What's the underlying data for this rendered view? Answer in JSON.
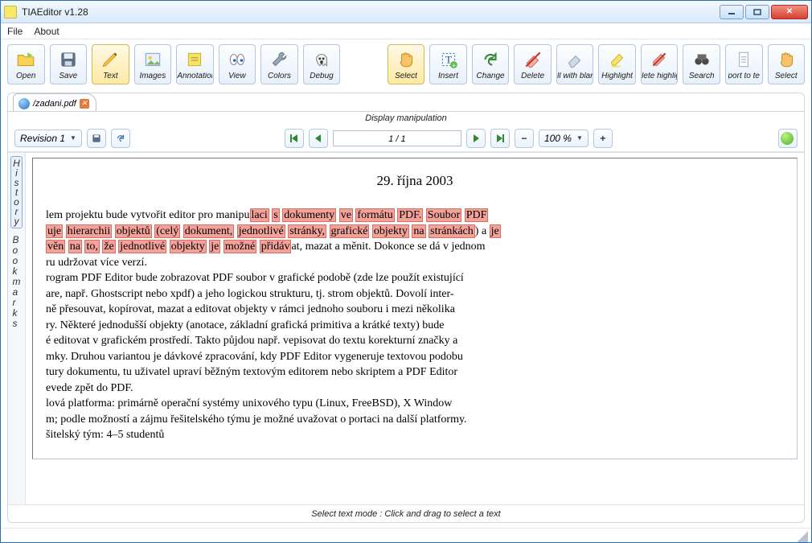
{
  "window": {
    "title": "TIAEditor v1.28"
  },
  "menu": {
    "file": "File",
    "about": "About"
  },
  "toolbar": [
    {
      "id": "open-button",
      "label": "Open"
    },
    {
      "id": "save-button",
      "label": "Save"
    },
    {
      "id": "text-button",
      "label": "Text",
      "selected": true
    },
    {
      "id": "images-button",
      "label": "Images"
    },
    {
      "id": "annotations-button",
      "label": "Annotations"
    },
    {
      "id": "view-button",
      "label": "View"
    },
    {
      "id": "colors-button",
      "label": "Colors"
    },
    {
      "id": "debug-button",
      "label": "Debug"
    }
  ],
  "toolbar2": [
    {
      "id": "select-button",
      "label": "Select",
      "selected": true
    },
    {
      "id": "insert-button",
      "label": "Insert"
    },
    {
      "id": "change-button",
      "label": "Change"
    },
    {
      "id": "delete-button",
      "label": "Delete"
    },
    {
      "id": "fill-blank-button",
      "label": "ll with blan"
    },
    {
      "id": "highlight-button",
      "label": "Highlight"
    },
    {
      "id": "delete-highlight-button",
      "label": "lete highlig"
    },
    {
      "id": "search-button",
      "label": "Search"
    },
    {
      "id": "port-to-te-button",
      "label": "port to te"
    },
    {
      "id": "select2-button",
      "label": "Select"
    }
  ],
  "tab": {
    "label": "/zadani.pdf"
  },
  "display_label": "Display manipulation",
  "revision": {
    "label": "Revision 1"
  },
  "page_counter": "1 / 1",
  "zoom": "100 %",
  "doc": {
    "date": "29. října 2003",
    "p1a": "lem projektu bude vytvořit editor pro manipu",
    "p1_hl": [
      "laci",
      "s",
      "dokumenty",
      "ve",
      "formátu",
      "PDF.",
      "Soubor",
      "PDF"
    ],
    "p2_hl1": [
      "uje",
      "hierarchii",
      "objektů",
      "(celý",
      "dokument,",
      "jednotlivé",
      "stránky,",
      "grafické",
      "objekty",
      "na",
      "stránkách"
    ],
    "p2_mid": ") a ",
    "p2_hl2": [
      "je"
    ],
    "p3_hl": [
      "věn",
      "na",
      "to,",
      "že",
      "jednotlivé",
      "objekty",
      "je",
      "možné",
      "přidáv"
    ],
    "p3b": "at, mazat a měnit. Dokonce se dá v jednom",
    "p4": "ru udržovat více verzí.",
    "p5": "rogram PDF Editor bude zobrazovat PDF soubor v grafické podobě (zde lze použít existující",
    "p6": "are, např. Ghostscript nebo xpdf) a jeho logickou strukturu, tj. strom objektů. Dovolí inter-",
    "p7": "ně přesouvat, kopírovat, mazat a editovat objekty v rámci jednoho souboru i mezi několika",
    "p8": "ry. Některé jednodušší objekty (anotace, základní grafická primitiva a krátké texty) bude",
    "p9": "é editovat v grafickém prostředí. Takto půjdou např. vepisovat do textu korekturní značky a",
    "p10": "mky. Druhou variantou je dávkové zpracování, kdy PDF Editor vygeneruje textovou podobu",
    "p11": "tury dokumentu, tu uživatel upraví běžným textovým editorem nebo skriptem a PDF Editor",
    "p12": "evede zpět do PDF.",
    "p13": "lová platforma: primárně operační systémy unixového typu (Linux, FreeBSD), X Window",
    "p14": "m; podle možností a zájmu řešitelského týmu je možné uvažovat o portaci na další platformy.",
    "p15": "šitelský tým: 4–5 studentů"
  },
  "side": {
    "history": [
      "H",
      "i",
      "s",
      "t",
      "o",
      "r",
      "y"
    ],
    "bookmarks": [
      "B",
      "o",
      "o",
      "k",
      "m",
      "a",
      "r",
      "k",
      "s"
    ]
  },
  "status": "Select text mode : Click and drag to select a text"
}
